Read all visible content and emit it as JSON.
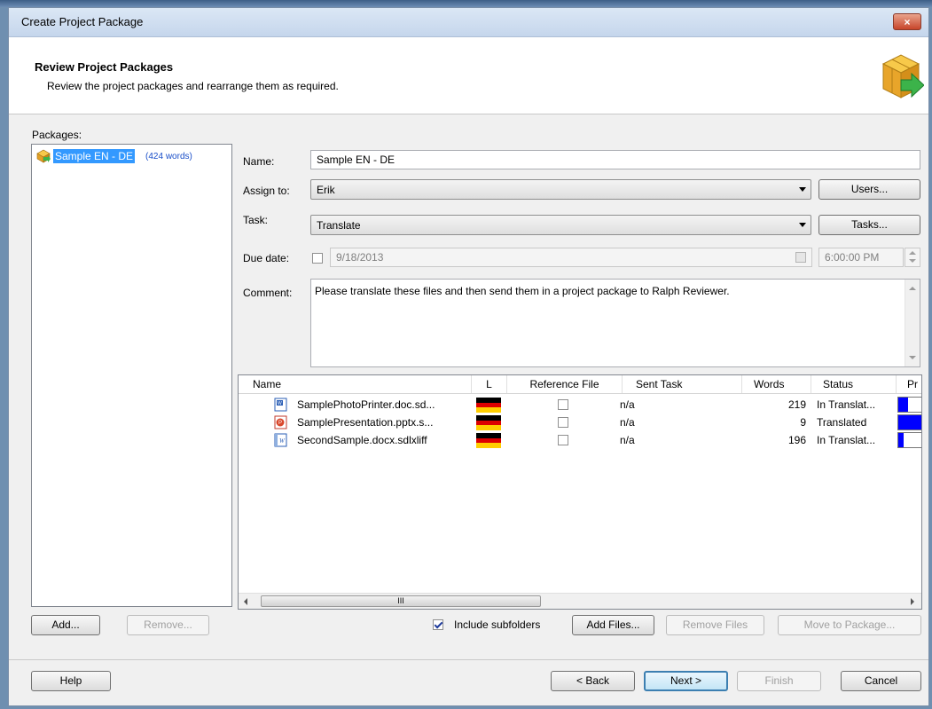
{
  "window": {
    "title": "Create Project Package",
    "close_label": "×"
  },
  "header": {
    "title": "Review Project Packages",
    "subtitle": "Review the project packages and  rearrange them as required.",
    "icon": "package-arrow-icon"
  },
  "packages": {
    "label": "Packages:",
    "items": [
      {
        "name": "Sample EN - DE",
        "words": "(424 words)"
      }
    ],
    "add_label": "Add...",
    "remove_label": "Remove..."
  },
  "form": {
    "name_label": "Name:",
    "name_value": "Sample EN - DE",
    "assign_label": "Assign to:",
    "assign_value": "Erik",
    "users_button": "Users...",
    "task_label": "Task:",
    "task_value": "Translate",
    "tasks_button": "Tasks...",
    "due_label": "Due date:",
    "due_value": "9/18/2013",
    "due_time": "6:00:00 PM",
    "comment_label": "Comment:",
    "comment_value": "Please translate these files and then send them in a project package to Ralph Reviewer."
  },
  "files": {
    "columns": [
      "Name",
      "L",
      "Reference File",
      "Sent Task",
      "Words",
      "Status",
      "Pr"
    ],
    "rows": [
      {
        "name": "SamplePhotoPrinter.doc.sd...",
        "icon": "word-doc-icon",
        "sent": "n/a",
        "words": "219",
        "status": "In Translat...",
        "progress": 0.4
      },
      {
        "name": "SamplePresentation.pptx.s...",
        "icon": "powerpoint-icon",
        "sent": "n/a",
        "words": "9",
        "status": "Translated",
        "progress": 1.0
      },
      {
        "name": "SecondSample.docx.sdlxliff",
        "icon": "word-docx-icon",
        "sent": "n/a",
        "words": "196",
        "status": "In Translat...",
        "progress": 0.2
      }
    ],
    "scroll_grip": "III"
  },
  "file_actions": {
    "include_subfolders": "Include subfolders",
    "add_files": "Add Files...",
    "remove_files": "Remove Files",
    "move_to_package": "Move to Package..."
  },
  "footer": {
    "help": "Help",
    "back": "< Back",
    "next": "Next >",
    "finish": "Finish",
    "cancel": "Cancel"
  },
  "colors": {
    "selection": "#3399ff",
    "progress": "#0000ff",
    "flag_black": "#000000",
    "flag_red": "#dd0000",
    "flag_gold": "#ffce00"
  }
}
